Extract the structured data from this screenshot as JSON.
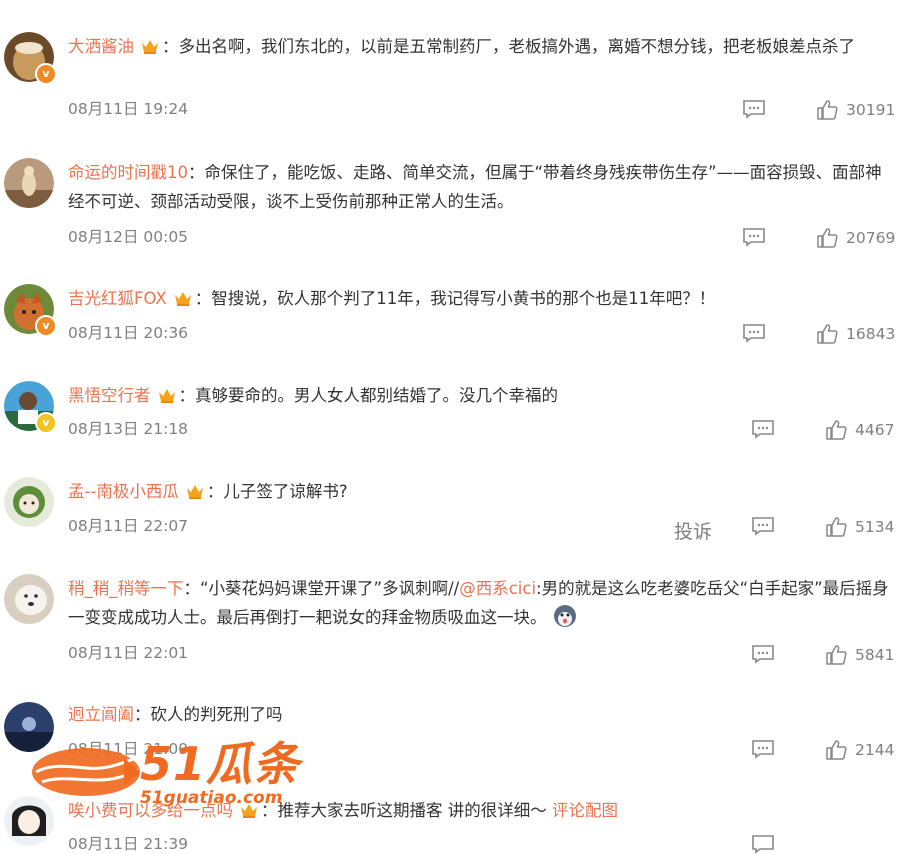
{
  "comments": [
    {
      "name": "大洒酱油",
      "text": "：多出名啊，我们东北的，以前是五常制药厂，老板搞外遇，离婚不想分钱，把老板娘差点杀了",
      "time": "08月11日 19:24",
      "likes": "30191",
      "has_crown": true,
      "verified": "orange"
    },
    {
      "name": "命运的时间戳10",
      "text": "：命保住了，能吃饭、走路、简单交流，但属于“带着终身残疾带伤生存”——面容损毁、面部神经不可逆、颈部活动受限，谈不上受伤前那种正常人的生活。",
      "time": "08月12日 00:05",
      "likes": "20769",
      "has_crown": false,
      "verified": ""
    },
    {
      "name": "吉光红狐FOX",
      "text": "：智搜说，砍人那个判了11年，我记得写小黄书的那个也是11年吧？！",
      "time": "08月11日 20:36",
      "likes": "16843",
      "has_crown": true,
      "verified": "orange"
    },
    {
      "name": "黑悟空行者",
      "text": "：真够要命的。男人女人都别结婚了。没几个幸福的",
      "time": "08月13日 21:18",
      "likes": "4467",
      "has_crown": true,
      "verified": "gold"
    },
    {
      "name": "孟--南极小西瓜",
      "text": "：儿子签了谅解书?",
      "time": "08月11日 22:07",
      "likes": "5134",
      "has_crown": true,
      "verified": "",
      "report": "投诉"
    },
    {
      "name": "稍_稍_稍等一下",
      "text_a": "：“小葵花妈妈课堂开课了”多讽刺啊//",
      "mention": "@西系cici",
      "text_b": ":男的就是这么吃老婆吃岳父“白手起家”最后摇身一变变成成功人士。最后再倒打一耙说女的拜金物质吸血这一块。",
      "time": "08月11日 22:01",
      "likes": "5841",
      "has_crown": false,
      "verified": ""
    },
    {
      "name": "迥立阊阖",
      "text": "：砍人的判死刑了吗",
      "time": "08月11日 21:00",
      "likes": "2144",
      "has_crown": false,
      "verified": ""
    },
    {
      "name": "唉小费可以多给一点吗",
      "text": "：推荐大家去听这期播客 讲的很详细～",
      "link": "评论配图",
      "time": "08月11日 21:39",
      "has_crown": true,
      "verified": ""
    }
  ],
  "watermark": {
    "brand": "51瓜条",
    "url": "51guatiao.com"
  },
  "colors": {
    "name": "#eb7350",
    "meta": "#808080",
    "text": "#333333",
    "watermark": "#f06a1f"
  }
}
